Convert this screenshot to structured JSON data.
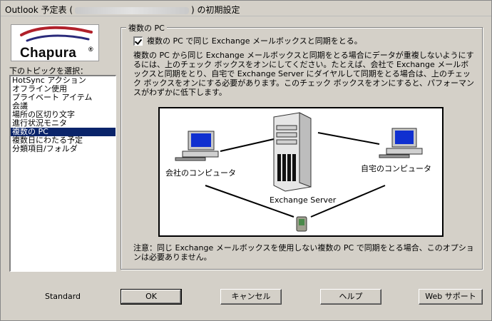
{
  "window": {
    "title_prefix": "Outlook 予定表 (",
    "title_suffix": ") の初期設定"
  },
  "logo": {
    "text": "Chapura",
    "reg": "®"
  },
  "topics": {
    "label": "下のトピックを選択：",
    "items": [
      {
        "label": "HotSync アクション",
        "selected": false
      },
      {
        "label": "オフライン使用",
        "selected": false
      },
      {
        "label": "プライベート アイテム",
        "selected": false
      },
      {
        "label": "会議",
        "selected": false
      },
      {
        "label": "場所の区切り文字",
        "selected": false
      },
      {
        "label": "進行状況モニタ",
        "selected": false
      },
      {
        "label": "複数の PC",
        "selected": true
      },
      {
        "label": "複数日にわたる予定",
        "selected": false
      },
      {
        "label": "分類項目/フォルダ",
        "selected": false
      }
    ]
  },
  "panel": {
    "legend": "複数の PC",
    "checkbox_label": "複数の PC で同じ Exchange メールボックスと同期をとる。",
    "checkbox_checked": true,
    "description": "複数の PC から同じ Exchange メールボックスと同期をとる場合にデータが重複しないようにするには、上のチェック ボックスをオンにしてください。たとえば、会社で Exchange メールボックスと同期をとり、自宅で Exchange Server にダイヤルして同期をとる場合は、上のチェック ボックスをオンにする必要があります。このチェック ボックスをオンにすると、パフォーマンスがわずかに低下します。",
    "diagram": {
      "office_label": "会社のコンピュータ",
      "home_label": "自宅のコンピュータ",
      "server_label": "Exchange Server"
    },
    "note": "注意：同じ Exchange メールボックスを使用しない複数の PC で同期をとる場合、このオプションは必要ありません。"
  },
  "footer": {
    "standard_label": "Standard",
    "ok_label": "OK",
    "cancel_label": "キャンセル",
    "help_label": "ヘルプ",
    "web_support_label": "Web サポート"
  }
}
